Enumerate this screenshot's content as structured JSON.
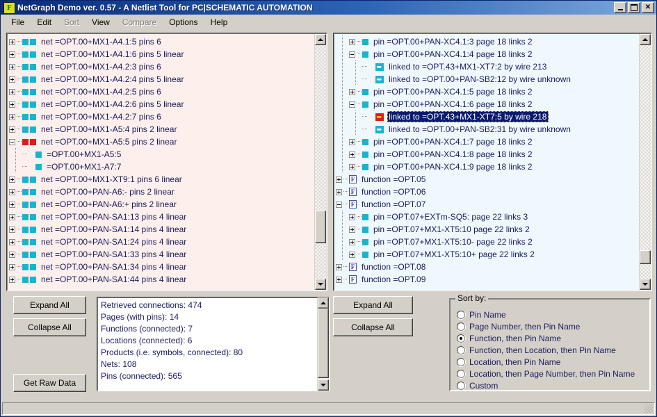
{
  "window": {
    "title": "NetGraph Demo ver. 0.57 - A Netlist Tool for PC|SCHEMATIC AUTOMATION",
    "icon_letter": "F",
    "minimize_label": "",
    "maximize_label": "",
    "close_label": "✕"
  },
  "menubar": {
    "items": [
      {
        "label": "File",
        "disabled": false
      },
      {
        "label": "Edit",
        "disabled": false
      },
      {
        "label": "Sort",
        "disabled": true
      },
      {
        "label": "View",
        "disabled": false
      },
      {
        "label": "Compare",
        "disabled": true
      },
      {
        "label": "Options",
        "disabled": false
      },
      {
        "label": "Help",
        "disabled": false
      }
    ]
  },
  "left_tree": {
    "rows": [
      {
        "depth": 1,
        "expander": "plus",
        "icon": "net-pair-cyan",
        "text": "net =OPT.00+MX1-A4.1:5   pins 6"
      },
      {
        "depth": 1,
        "expander": "plus",
        "icon": "net-pair-cyan",
        "text": "net =OPT.00+MX1-A4.1:6   pins 5   linear"
      },
      {
        "depth": 1,
        "expander": "plus",
        "icon": "net-pair-cyan",
        "text": "net =OPT.00+MX1-A4.2:3   pins 6"
      },
      {
        "depth": 1,
        "expander": "plus",
        "icon": "net-pair-cyan",
        "text": "net =OPT.00+MX1-A4.2:4   pins 5   linear"
      },
      {
        "depth": 1,
        "expander": "plus",
        "icon": "net-pair-cyan",
        "text": "net =OPT.00+MX1-A4.2:5   pins 6"
      },
      {
        "depth": 1,
        "expander": "plus",
        "icon": "net-pair-cyan",
        "text": "net =OPT.00+MX1-A4.2:6   pins 5   linear"
      },
      {
        "depth": 1,
        "expander": "plus",
        "icon": "net-pair-cyan",
        "text": "net =OPT.00+MX1-A4.2:7   pins 6"
      },
      {
        "depth": 1,
        "expander": "plus",
        "icon": "net-pair-cyan",
        "text": "net =OPT.00+MX1-A5:4   pins 2   linear"
      },
      {
        "depth": 1,
        "expander": "minus",
        "icon": "net-pair-red",
        "text": "net =OPT.00+MX1-A5:5   pins 2   linear"
      },
      {
        "depth": 2,
        "expander": "none",
        "icon": "pin-cyan",
        "text": "=OPT.00+MX1-A5:5"
      },
      {
        "depth": 2,
        "expander": "none",
        "icon": "pin-cyan",
        "text": "=OPT.00+MX1-A7:7"
      },
      {
        "depth": 1,
        "expander": "plus",
        "icon": "net-pair-cyan",
        "text": "net =OPT.00+MX1-XT9:1   pins 6   linear"
      },
      {
        "depth": 1,
        "expander": "plus",
        "icon": "net-pair-cyan",
        "text": "net =OPT.00+PAN-A6:-   pins 2   linear"
      },
      {
        "depth": 1,
        "expander": "plus",
        "icon": "net-pair-cyan",
        "text": "net =OPT.00+PAN-A6:+   pins 2   linear"
      },
      {
        "depth": 1,
        "expander": "plus",
        "icon": "net-pair-cyan",
        "text": "net =OPT.00+PAN-SA1:13   pins 4   linear"
      },
      {
        "depth": 1,
        "expander": "plus",
        "icon": "net-pair-cyan",
        "text": "net =OPT.00+PAN-SA1:14   pins 4   linear"
      },
      {
        "depth": 1,
        "expander": "plus",
        "icon": "net-pair-cyan",
        "text": "net =OPT.00+PAN-SA1:24   pins 4   linear"
      },
      {
        "depth": 1,
        "expander": "plus",
        "icon": "net-pair-cyan",
        "text": "net =OPT.00+PAN-SA1:33   pins 4   linear"
      },
      {
        "depth": 1,
        "expander": "plus",
        "icon": "net-pair-cyan",
        "text": "net =OPT.00+PAN-SA1:34   pins 4   linear"
      },
      {
        "depth": 1,
        "expander": "plus",
        "icon": "net-pair-cyan",
        "text": "net =OPT.00+PAN-SA1:44   pins 4   linear"
      }
    ],
    "scroll": {
      "thumb_top_pct": 82,
      "thumb_height_pct": 14
    }
  },
  "right_tree": {
    "rows": [
      {
        "depth": 2,
        "expander": "plus",
        "icon": "pin-cyan",
        "text": "pin =OPT.00+PAN-XC4.1:3   page 18   links 2",
        "selected": false
      },
      {
        "depth": 2,
        "expander": "minus",
        "icon": "pin-cyan",
        "text": "pin =OPT.00+PAN-XC4.1:4   page 18   links 2",
        "selected": false
      },
      {
        "depth": 3,
        "expander": "none",
        "icon": "link",
        "text": "linked to =OPT.43+MX1-XT7:2   by wire 213",
        "selected": false
      },
      {
        "depth": 3,
        "expander": "none",
        "icon": "link",
        "text": "linked to =OPT.00+PAN-SB2:12   by wire unknown",
        "selected": false
      },
      {
        "depth": 2,
        "expander": "plus",
        "icon": "pin-cyan",
        "text": "pin =OPT.00+PAN-XC4.1:5   page 18   links 2",
        "selected": false
      },
      {
        "depth": 2,
        "expander": "minus",
        "icon": "pin-cyan",
        "text": "pin =OPT.00+PAN-XC4.1:6   page 18   links 2",
        "selected": false
      },
      {
        "depth": 3,
        "expander": "none",
        "icon": "link-sel",
        "text": "linked to =OPT.43+MX1-XT7:5   by wire 218",
        "selected": true
      },
      {
        "depth": 3,
        "expander": "none",
        "icon": "link",
        "text": "linked to =OPT.00+PAN-SB2:31   by wire unknown",
        "selected": false
      },
      {
        "depth": 2,
        "expander": "plus",
        "icon": "pin-cyan",
        "text": "pin =OPT.00+PAN-XC4.1:7   page 18   links 2",
        "selected": false
      },
      {
        "depth": 2,
        "expander": "plus",
        "icon": "pin-cyan",
        "text": "pin =OPT.00+PAN-XC4.1:8   page 18   links 2",
        "selected": false
      },
      {
        "depth": 2,
        "expander": "plus",
        "icon": "pin-cyan",
        "text": "pin =OPT.00+PAN-XC4.1:9   page 18   links 2",
        "selected": false
      },
      {
        "depth": 1,
        "expander": "plus",
        "icon": "function",
        "text": "function =OPT.05",
        "selected": false
      },
      {
        "depth": 1,
        "expander": "plus",
        "icon": "function",
        "text": "function =OPT.06",
        "selected": false
      },
      {
        "depth": 1,
        "expander": "minus",
        "icon": "function",
        "text": "function =OPT.07",
        "selected": false
      },
      {
        "depth": 2,
        "expander": "plus",
        "icon": "pin-cyan",
        "text": "pin =OPT.07+EXTm-SQ5:   page 22   links 3",
        "selected": false
      },
      {
        "depth": 2,
        "expander": "plus",
        "icon": "pin-cyan",
        "text": "pin =OPT.07+MX1-XT5:10   page 22   links 2",
        "selected": false
      },
      {
        "depth": 2,
        "expander": "plus",
        "icon": "pin-cyan",
        "text": "pin =OPT.07+MX1-XT5:10-   page 22   links 2",
        "selected": false
      },
      {
        "depth": 2,
        "expander": "plus",
        "icon": "pin-cyan",
        "text": "pin =OPT.07+MX1-XT5:10+   page 22   links 2",
        "selected": false
      },
      {
        "depth": 1,
        "expander": "plus",
        "icon": "function",
        "text": "function =OPT.08",
        "selected": false
      },
      {
        "depth": 1,
        "expander": "plus",
        "icon": "function",
        "text": "function =OPT.09",
        "selected": false
      }
    ],
    "scroll": {
      "thumb_top_pct": 93,
      "thumb_height_pct": 6
    }
  },
  "buttons": {
    "expand_all_left": "Expand All",
    "collapse_all_left": "Collapse All",
    "get_raw_data": "Get Raw Data",
    "expand_all_right": "Expand All",
    "collapse_all_right": "Collapse All"
  },
  "stats": {
    "lines": [
      "Retrieved connections: 474",
      "Pages (with pins): 14",
      "Functions (connected): 7",
      "Locations (connected): 6",
      "Products (i.e. symbols, connected): 80",
      "Nets: 108",
      "Pins (connected): 565"
    ]
  },
  "sort_group": {
    "title": "Sort by:",
    "options": [
      {
        "label": "Pin Name",
        "selected": false
      },
      {
        "label": "Page Number, then Pin Name",
        "selected": false
      },
      {
        "label": "Function, then Pin Name",
        "selected": true
      },
      {
        "label": "Function, then Location, then Pin Name",
        "selected": false
      },
      {
        "label": "Location, then Pin Name",
        "selected": false
      },
      {
        "label": "Location, then Page Number, then Pin Name",
        "selected": false
      },
      {
        "label": "Custom",
        "selected": false
      }
    ]
  },
  "colors": {
    "titlebar_start": "#0b2a7a",
    "titlebar_end": "#7fa8dc",
    "left_panel_bg": "#fdf0ec",
    "right_panel_bg": "#eff9fd",
    "tree_text": "#1a1a5e",
    "selection_bg": "#0a1a6e",
    "icon_cyan": "#1ab3cf",
    "icon_red": "#e01b1b",
    "face": "#d4d0c8"
  }
}
